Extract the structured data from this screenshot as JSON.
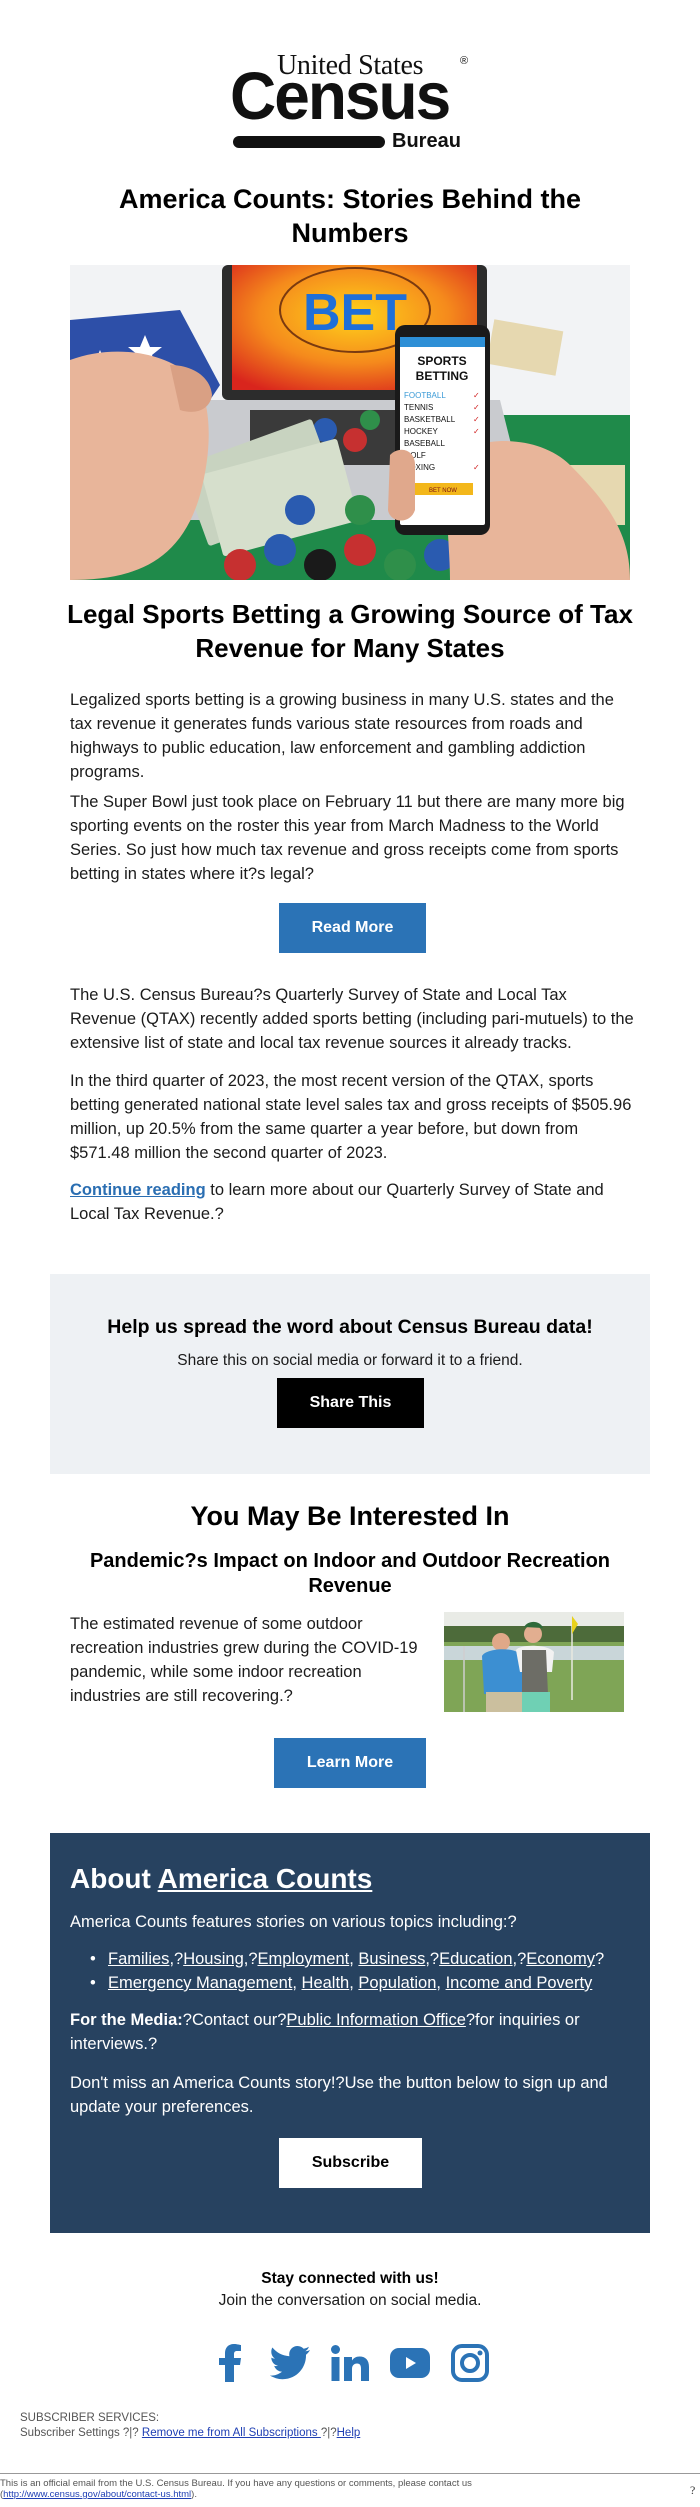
{
  "brand": {
    "logo_line1": "United States",
    "logo_reg": "®",
    "logo_line2": "Census",
    "logo_line3": "Bureau"
  },
  "header": {
    "title": "America Counts: Stories Behind the Numbers"
  },
  "hero_image": {
    "alt": "Sports betting app on phone in front of laptop showing BET",
    "screen_text": "BET",
    "phone_title": "SPORTS BETTING",
    "phone_items": [
      "FOOTBALL",
      "TENNIS",
      "BASKETBALL",
      "HOCKEY",
      "BASEBALL",
      "GOLF",
      "BOXING"
    ],
    "phone_button": "BET NOW"
  },
  "story": {
    "title": "Legal Sports Betting a Growing Source of Tax Revenue for Many States",
    "paragraph1": "Legalized sports betting is a growing business in many U.S. states and the tax revenue it generates funds various state resources from roads and highways to public education, law enforcement and gambling addiction programs.",
    "paragraph2": "The Super Bowl just took place on February 11 but there are many more big sporting events on the roster this year from March Madness to the World Series. So just how much tax revenue and gross receipts come from sports betting in states where it?s legal?",
    "read_more_label": "Read More",
    "paragraph3": "The U.S. Census Bureau?s Quarterly Survey of State and Local Tax Revenue (QTAX) recently added sports betting (including pari-mutuels) to the extensive list of state and local tax revenue sources it already tracks.",
    "paragraph4": "In the third quarter of 2023, the most recent version of the QTAX, sports betting generated national state level sales tax and gross receipts of $505.96 million, up 20.5% from the same quarter a year before, but down from $571.48 million the second quarter of 2023.",
    "continue_link": "Continue reading",
    "paragraph5_rest": " to learn more about our Quarterly Survey of State and Local Tax Revenue.?"
  },
  "share": {
    "title": "Help us spread the word about Census Bureau data!",
    "subtitle": "Share this on social media or forward it to a friend.",
    "button_label": "Share This"
  },
  "interested": {
    "heading": "You May Be Interested In",
    "article_title": "Pandemic?s Impact on Indoor and Outdoor Recreation Revenue",
    "article_text": "The estimated revenue of some outdoor recreation industries grew during the COVID-19 pandemic, while some indoor recreation industries are still recovering.?",
    "image_alt": "Two men smiling on a golf course",
    "button_label": "Learn More"
  },
  "about": {
    "title_prefix": "About ",
    "title_link": "America Counts",
    "intro": "America Counts features stories on various topics including:?",
    "topics_row1": [
      {
        "label": "Families",
        "sep": ",?"
      },
      {
        "label": "Housing",
        "sep": ",?"
      },
      {
        "label": "Employment",
        "sep": ", "
      },
      {
        "label": "Business",
        "sep": ",?"
      },
      {
        "label": "Education",
        "sep": ",?"
      },
      {
        "label": "Economy",
        "sep": "?"
      }
    ],
    "topics_row2": [
      {
        "label": "Emergency Management",
        "sep": ", "
      },
      {
        "label": "Health",
        "sep": ", "
      },
      {
        "label": "Population",
        "sep": ", "
      },
      {
        "label": "Income and Poverty",
        "sep": ""
      }
    ],
    "media_label": "For the Media:",
    "media_text1": "?Contact our?",
    "media_link": "Public Information Office",
    "media_text2": "?for inquiries or interviews.?",
    "dont_miss": "Don't miss an America Counts story!?Use the button below to sign up and update your preferences.",
    "subscribe_label": "Subscribe"
  },
  "social": {
    "title": "Stay connected with us!",
    "subtitle": "Join the conversation on social media.",
    "icon_color": "#2b73b6",
    "icons": [
      "facebook-icon",
      "twitter-icon",
      "linkedin-icon",
      "youtube-icon",
      "instagram-icon"
    ]
  },
  "footer": {
    "subscriber_services": "SUBSCRIBER SERVICES:",
    "settings_text": "Subscriber Settings ?|? ",
    "remove_link": "Remove me from All Subscriptions ",
    "sep2": "?|?",
    "help_link": "Help",
    "official_text": "This is an official email from the U.S. Census Bureau. If you have any questions or comments, please contact us",
    "contact_open": "(",
    "contact_link": "http://www.census.gov/about/contact-us.html",
    "contact_close": ").",
    "trailing_mark": "?"
  },
  "colors": {
    "button_blue": "#2b73b6",
    "about_bg": "#274260",
    "share_bg": "#eef1f4",
    "link_blue": "#2a6eb2"
  }
}
